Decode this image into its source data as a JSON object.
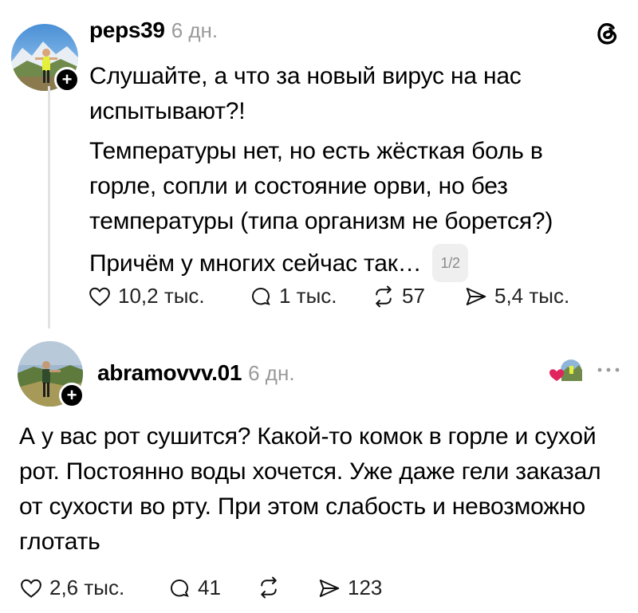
{
  "post1": {
    "username": "peps39",
    "time": "6 дн.",
    "paragraphs": [
      "Слушайте, а что за новый вирус на нас испытывают?!",
      "Температуры нет, но есть жёсткая боль в горле, сопли и состояние орви, но без температуры (типа организм не борется?)",
      "Причём у многих сейчас так…"
    ],
    "page_badge": "1/2",
    "likes": "10,2 тыс.",
    "replies": "1 тыс.",
    "reposts": "57",
    "shares": "5,4 тыс."
  },
  "post2": {
    "username": "abramovvv.01",
    "time": "6 дн.",
    "text": "А у вас рот сушится? Какой-то комок в горле и сухой рот. Постоянно воды хочется. Уже даже гели заказал от сухости во рту. При этом слабость и невозможно глотать",
    "likes": "2,6 тыс.",
    "replies": "41",
    "reposts": "",
    "shares": "123"
  },
  "icons": {
    "threads": "threads-logo-icon",
    "more": "more-dots-icon",
    "liked_by_author": "heart-icon"
  },
  "colors": {
    "heart_red": "#e0245e",
    "muted": "#9a9a9a"
  }
}
